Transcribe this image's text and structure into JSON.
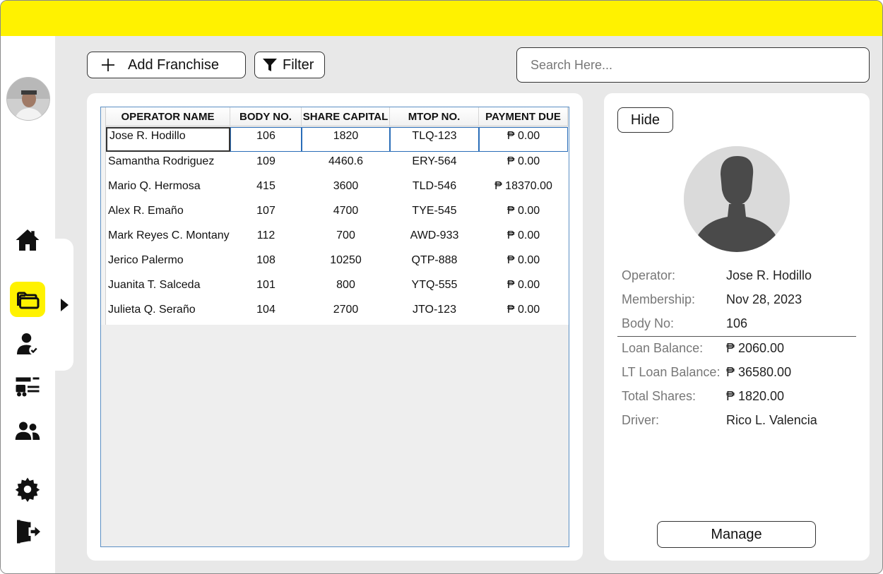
{
  "toolbar": {
    "add_label": "Add Franchise",
    "filter_label": "Filter",
    "search_placeholder": "Search Here..."
  },
  "table": {
    "columns": [
      "OPERATOR NAME",
      "BODY NO.",
      "SHARE CAPITAL",
      "MTOP NO.",
      "PAYMENT DUE"
    ],
    "rows": [
      [
        "Jose R. Hodillo",
        "106",
        "1820",
        "TLQ-123",
        "₱ 0.00"
      ],
      [
        "Samantha Rodriguez",
        "109",
        "4460.6",
        "ERY-564",
        "₱ 0.00"
      ],
      [
        "Mario Q. Hermosa",
        "415",
        "3600",
        "TLD-546",
        "₱ 18370.00"
      ],
      [
        "Alex R. Emaño",
        "107",
        "4700",
        "TYE-545",
        "₱ 0.00"
      ],
      [
        "Mark Reyes C. Montany",
        "112",
        "700",
        "AWD-933",
        "₱ 0.00"
      ],
      [
        "Jerico Palermo",
        "108",
        "10250",
        "QTP-888",
        "₱ 0.00"
      ],
      [
        "Juanita T. Salceda",
        "101",
        "800",
        "YTQ-555",
        "₱ 0.00"
      ],
      [
        "Julieta Q. Seraño",
        "104",
        "2700",
        "JTO-123",
        "₱ 0.00"
      ]
    ]
  },
  "detail": {
    "hide_label": "Hide",
    "manage_label": "Manage",
    "operator_label": "Operator:",
    "operator": "Jose R. Hodillo",
    "membership_label": "Membership:",
    "membership": "Nov 28, 2023",
    "body_no_label": "Body No:",
    "body_no": "106",
    "loan_balance_label": "Loan Balance:",
    "loan_balance": "₱ 2060.00",
    "lt_loan_balance_label": "LT Loan Balance:",
    "lt_loan_balance": "₱ 36580.00",
    "total_shares_label": "Total Shares:",
    "total_shares": "₱ 1820.00",
    "driver_label": "Driver:",
    "driver": "Rico L. Valencia"
  },
  "nav": {
    "items": [
      "home-icon",
      "franchise-folder-icon",
      "user-verified-icon",
      "vehicles-icon",
      "members-icon",
      "settings-icon",
      "logout-icon"
    ],
    "active": "franchise-folder-icon"
  },
  "colors": {
    "accent": "#fff200",
    "background": "#e8e8e8",
    "selection_border": "#2a6db8"
  }
}
